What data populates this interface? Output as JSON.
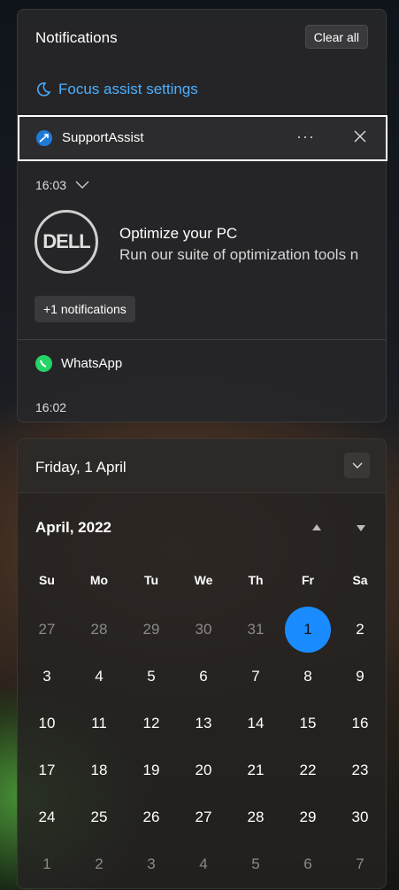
{
  "notifications": {
    "title": "Notifications",
    "clear_all": "Clear all",
    "focus_assist": "Focus assist settings",
    "group": {
      "app": "SupportAssist",
      "more": "···",
      "time": "16:03",
      "logo_text": "DELL",
      "toast_title": "Optimize your PC",
      "toast_body": "Run our suite of optimization tools n",
      "more_count": "+1 notifications"
    },
    "whatsapp": {
      "app": "WhatsApp",
      "time": "16:02"
    },
    "colors": {
      "accent": "#4cb0ff",
      "whatsapp": "#25d366",
      "supportassist": "#1e7ad6"
    }
  },
  "calendar": {
    "date_header": "Friday, 1 April",
    "month_label": "April, 2022",
    "weekdays": [
      "Su",
      "Mo",
      "Tu",
      "We",
      "Th",
      "Fr",
      "Sa"
    ],
    "weeks": [
      [
        "27",
        "28",
        "29",
        "30",
        "31",
        "1",
        "2"
      ],
      [
        "3",
        "4",
        "5",
        "6",
        "7",
        "8",
        "9"
      ],
      [
        "10",
        "11",
        "12",
        "13",
        "14",
        "15",
        "16"
      ],
      [
        "17",
        "18",
        "19",
        "20",
        "21",
        "22",
        "23"
      ],
      [
        "24",
        "25",
        "26",
        "27",
        "28",
        "29",
        "30"
      ],
      [
        "1",
        "2",
        "3",
        "4",
        "5",
        "6",
        "7"
      ]
    ],
    "today_color": "#1a8cff"
  }
}
